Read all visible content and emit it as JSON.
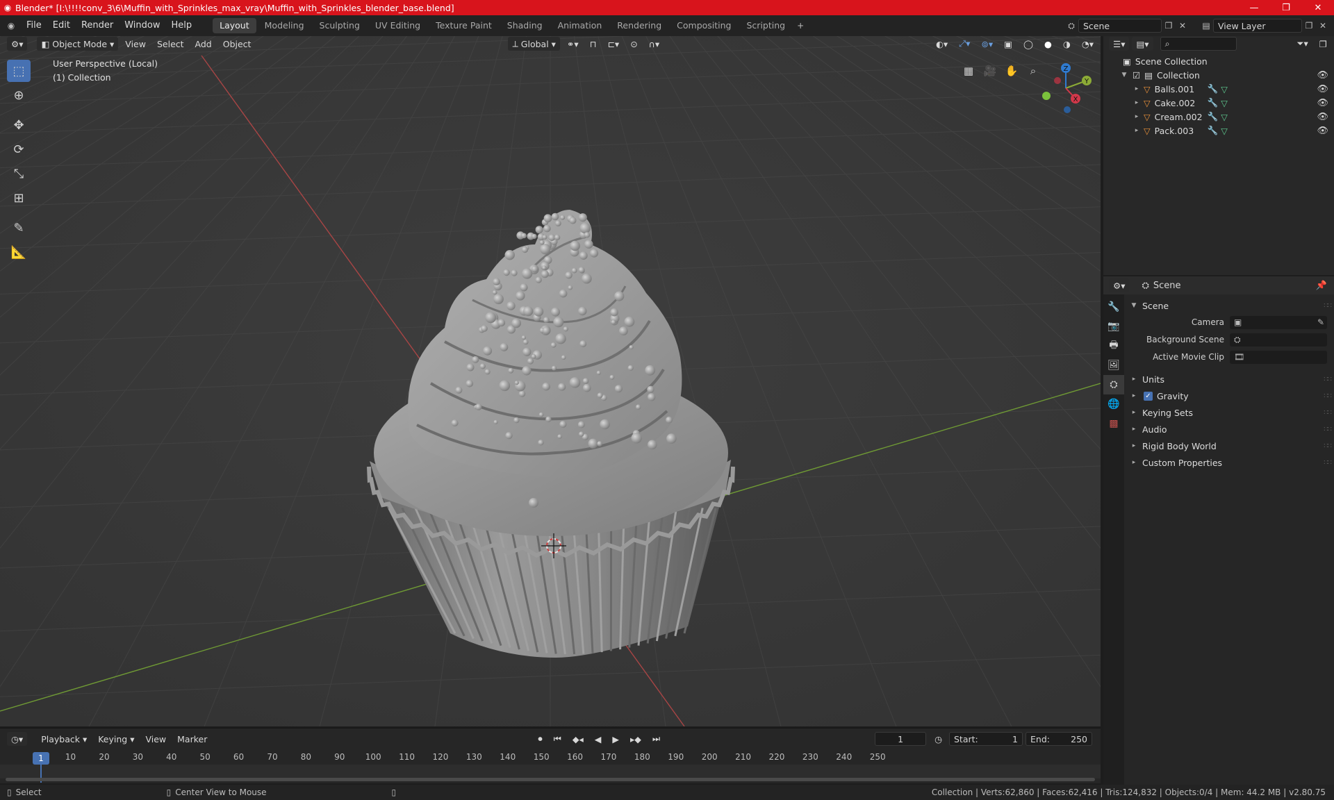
{
  "titlebar": {
    "title": "Blender* [I:\\!!!!conv_3\\6\\Muffin_with_Sprinkles_max_vray\\Muffin_with_Sprinkles_blender_base.blend]",
    "minimize": "—",
    "maximize": "❐",
    "close": "✕"
  },
  "menu": [
    "File",
    "Edit",
    "Render",
    "Window",
    "Help"
  ],
  "workspaces": [
    "Layout",
    "Modeling",
    "Sculpting",
    "UV Editing",
    "Texture Paint",
    "Shading",
    "Animation",
    "Rendering",
    "Compositing",
    "Scripting"
  ],
  "scene_name": "Scene",
  "view_layer": "View Layer",
  "viewport": {
    "mode": "Object Mode",
    "menus": [
      "View",
      "Select",
      "Add",
      "Object"
    ],
    "transform_orientation": "Global",
    "info_line1": "User Perspective (Local)",
    "info_line2": "(1) Collection",
    "gizmo": {
      "z": "Z",
      "y": "Y",
      "x": "X"
    }
  },
  "outliner": {
    "root": "Scene Collection",
    "collection": "Collection",
    "items": [
      "Balls.001",
      "Cake.002",
      "Cream.002",
      "Pack.003"
    ],
    "search_placeholder": ""
  },
  "properties": {
    "header": "Scene",
    "section": "Scene",
    "fields": [
      {
        "label": "Camera",
        "value": ""
      },
      {
        "label": "Background Scene",
        "value": ""
      },
      {
        "label": "Active Movie Clip",
        "value": ""
      }
    ],
    "panels": [
      "Units",
      "Gravity",
      "Keying Sets",
      "Audio",
      "Rigid Body World",
      "Custom Properties"
    ],
    "gravity_checked": true
  },
  "timeline": {
    "menus": [
      "Playback",
      "Keying",
      "View",
      "Marker"
    ],
    "current_frame": "1",
    "start_label": "Start:",
    "start": "1",
    "end_label": "End:",
    "end": "250",
    "ticks": [
      "1",
      "10",
      "20",
      "30",
      "40",
      "50",
      "60",
      "70",
      "80",
      "90",
      "100",
      "110",
      "120",
      "130",
      "140",
      "150",
      "160",
      "170",
      "180",
      "190",
      "200",
      "210",
      "220",
      "230",
      "240",
      "250"
    ]
  },
  "statusbar": {
    "left_action": "Select",
    "middle_action": "Center View to Mouse",
    "stats": "Collection | Verts:62,860 | Faces:62,416 | Tris:124,832 | Objects:0/4 | Mem: 44.2 MB | v2.80.75"
  },
  "colors": {
    "title_red": "#d8141c",
    "accent_blue": "#4772b3",
    "object_orange": "#e8913a",
    "modifier_blue": "#6a9fe0",
    "mesh_green": "#5ec990",
    "axis_x_red": "#c84848",
    "axis_y_green": "#7ea83c"
  }
}
